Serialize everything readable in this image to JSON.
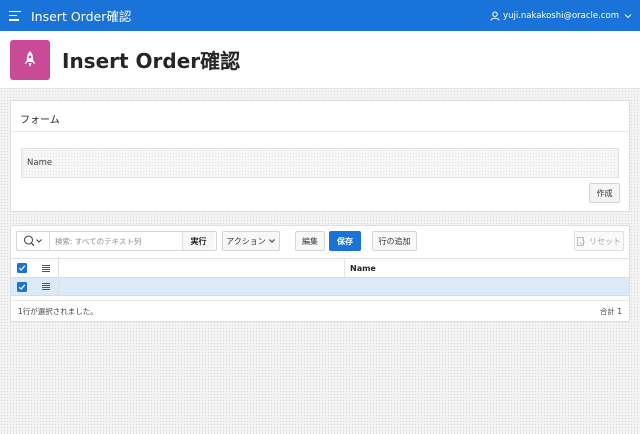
{
  "topbar": {
    "app_title": "Insert Order確認",
    "user_name": "yuji.nakakoshi@oracle.com"
  },
  "header": {
    "page_title": "Insert Order確認",
    "icon": "rocket-icon"
  },
  "form": {
    "region_title": "フォーム",
    "name_label": "Name",
    "create_label": "作成"
  },
  "grid": {
    "search_placeholder": "検索: すべてのテキスト列",
    "go_label": "実行",
    "actions_label": "アクション",
    "edit_label": "編集",
    "save_label": "保存",
    "add_row_label": "行の追加",
    "reset_label": "リセット",
    "columns": [
      "Name"
    ],
    "rows": [
      {
        "name": "",
        "selected": true
      }
    ],
    "footer_selected": "1行が選択されました。",
    "footer_total": "合計 1"
  },
  "colors": {
    "accent": "#1a73d9",
    "page_icon": "#c94b98",
    "selected_row": "#dbeaf7"
  }
}
